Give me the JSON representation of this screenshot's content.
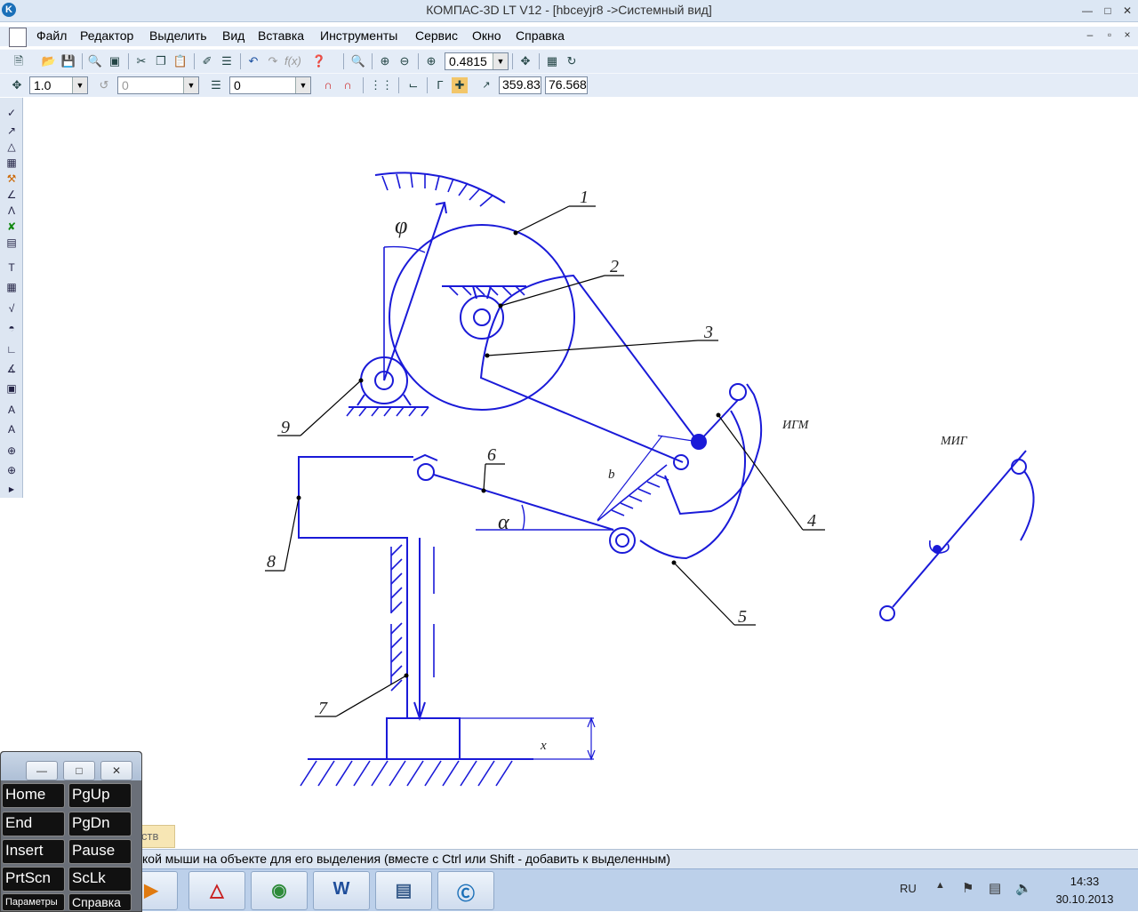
{
  "window": {
    "title": "КОМПАС-3D LT V12 - [hbceyjr8 ->Системный вид]",
    "logo_text": "K"
  },
  "menu": [
    "Файл",
    "Редактор",
    "Выделить",
    "Вид",
    "Вставка",
    "Инструменты",
    "Сервис",
    "Окно",
    "Справка"
  ],
  "toolbar1": {
    "zoom_value": "0.4815",
    "icons": [
      "new-icon",
      "open-icon",
      "save-icon",
      "print-preview-icon",
      "view-icon",
      "cut-icon",
      "copy-icon",
      "paste-icon",
      "brush-icon",
      "properties-icon",
      "undo-icon",
      "redo-icon",
      "fx-icon",
      "help-cursor-icon",
      "zoom-window-icon",
      "zoom-in-icon",
      "zoom-out-icon",
      "zoom-scale-icon",
      "pan-icon",
      "refresh-icon",
      "redraw-icon"
    ]
  },
  "toolbar2": {
    "step_value": "1.0",
    "angle_value": "0",
    "layer_value": "0",
    "coord_x": "359.83",
    "coord_y": "76.568"
  },
  "drawing": {
    "labels": {
      "l1": "1",
      "l2": "2",
      "l3": "3",
      "l4": "4",
      "l5": "5",
      "l6": "6",
      "l7": "7",
      "l8": "8",
      "l9": "9",
      "phi": "φ",
      "alpha": "α",
      "b": "b",
      "x": "x",
      "igm": "ИГМ",
      "mig": "МИГ"
    }
  },
  "bottom_tab": "ств",
  "status_text": "кой мыши на объекте для его выделения (вместе с Ctrl или Shift - добавить к выделенным)",
  "taskbar": {
    "lang": "RU",
    "time": "14:33",
    "date": "30.10.2013"
  },
  "osk": {
    "keys": [
      "Home",
      "PgUp",
      "End",
      "PgDn",
      "Insert",
      "Pause",
      "PrtScn",
      "ScLk"
    ],
    "bottom": [
      "Параметры",
      "Справка"
    ]
  }
}
